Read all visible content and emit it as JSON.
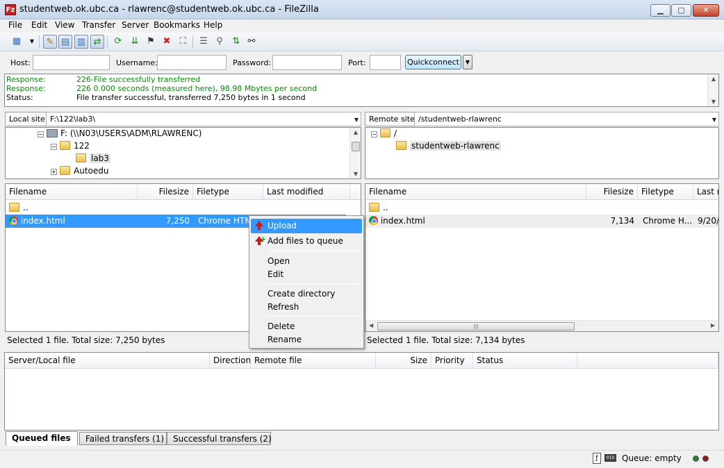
{
  "window": {
    "title": "studentweb.ok.ubc.ca - rlawrenc@studentweb.ok.ubc.ca - FileZilla",
    "app_icon": "Fz",
    "min": "▁",
    "max": "▢",
    "close": "✕"
  },
  "menu": [
    "File",
    "Edit",
    "View",
    "Transfer",
    "Server",
    "Bookmarks",
    "Help"
  ],
  "toolbar_icons": [
    "site-manager-icon",
    "toggle-log-icon",
    "toggle-local-tree-icon",
    "toggle-remote-tree-icon",
    "toggle-queue-icon",
    "refresh-icon",
    "process-queue-icon",
    "cancel-icon",
    "disconnect-icon",
    "reconnect-icon",
    "filter-icon",
    "compare-icon",
    "sync-browse-icon",
    "search-icon"
  ],
  "quickconnect": {
    "host_label": "Host:",
    "username_label": "Username:",
    "password_label": "Password:",
    "port_label": "Port:",
    "host_value": "",
    "username_value": "",
    "password_value": "",
    "port_value": "",
    "button_label": "Quickconnect"
  },
  "log": [
    {
      "type": "Response:",
      "text": "226-File successfully transferred",
      "color": "#0a8a0a"
    },
    {
      "type": "Response:",
      "text": "226 0.000 seconds (measured here), 98.98 Mbytes per second",
      "color": "#0a8a0a"
    },
    {
      "type": "Status:",
      "text": "File transfer successful, transferred 7,250 bytes in 1 second",
      "color": "#000000"
    }
  ],
  "local": {
    "site_label": "Local site:",
    "path": "F:\\122\\lab3\\",
    "tree": [
      {
        "label": "F: (\\\\N03\\USERS\\ADM\\RLAWRENC)",
        "expander": "−"
      },
      {
        "label": "122",
        "expander": "−"
      },
      {
        "label": "lab3",
        "expander": ""
      },
      {
        "label": "Autoedu",
        "expander": "+"
      }
    ],
    "columns": [
      "Filename",
      "Filesize",
      "Filetype",
      "Last modified"
    ],
    "files": [
      {
        "name": "..",
        "size": "",
        "type": "",
        "modified": ""
      },
      {
        "name": "index.html",
        "size": "7,250",
        "type": "Chrome HTM",
        "modified": ""
      }
    ],
    "status": "Selected 1 file. Total size: 7,250 bytes"
  },
  "remote": {
    "site_label": "Remote site:",
    "path": "/studentweb-rlawrenc",
    "tree": [
      {
        "label": "/",
        "expander": "−"
      },
      {
        "label": "studentweb-rlawrenc",
        "expander": ""
      }
    ],
    "columns": [
      "Filename",
      "Filesize",
      "Filetype",
      "Last r"
    ],
    "files": [
      {
        "name": "..",
        "size": "",
        "type": "",
        "modified": ""
      },
      {
        "name": "index.html",
        "size": "7,134",
        "type": "Chrome H...",
        "modified": "9/20/."
      }
    ],
    "status": "Selected 1 file. Total size: 7,134 bytes"
  },
  "context_menu": {
    "upload": "Upload",
    "add_to_queue": "Add files to queue",
    "open": "Open",
    "edit": "Edit",
    "create_directory": "Create directory",
    "refresh": "Refresh",
    "delete": "Delete",
    "rename": "Rename"
  },
  "queue": {
    "columns": [
      "Server/Local file",
      "Direction",
      "Remote file",
      "Size",
      "Priority",
      "Status"
    ],
    "tabs": [
      "Queued files",
      "Failed transfers (1)",
      "Successful transfers (2)"
    ],
    "status": "Queue: empty"
  },
  "colors": {
    "selection": "#3399ff",
    "log_green": "#0a8a0a",
    "led_green": "#2e7d32",
    "led_red": "#8b1a1a"
  }
}
